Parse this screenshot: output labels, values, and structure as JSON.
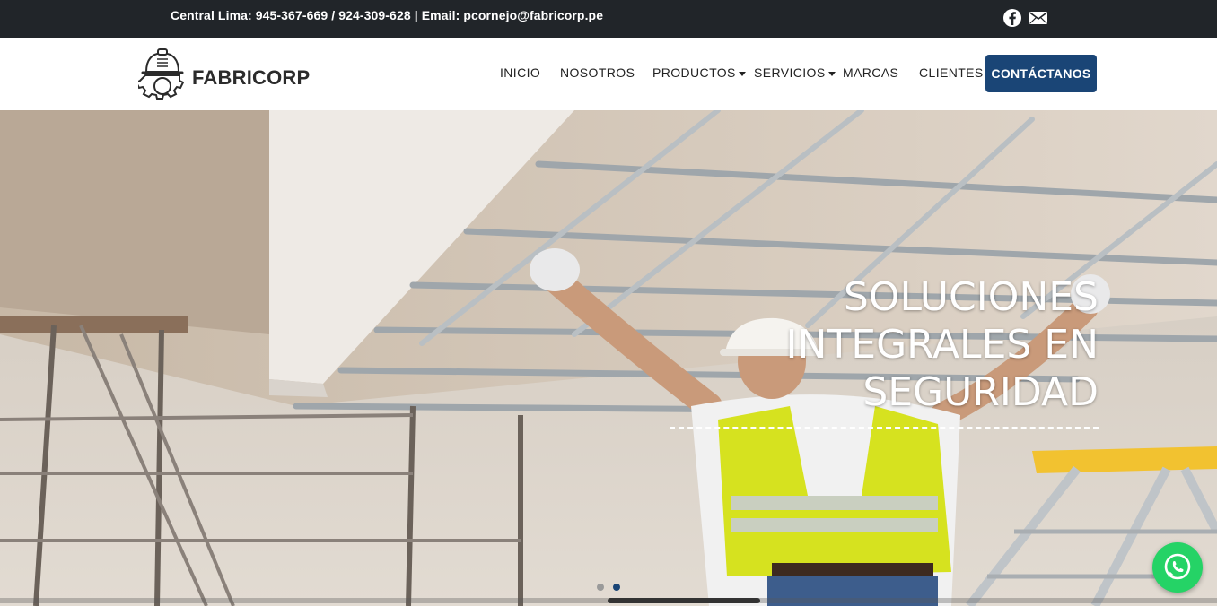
{
  "topbar": {
    "contact_text": "Central Lima: 945-367-669 / 924-309-628 | Email: pcornejo@fabricorp.pe",
    "icons": [
      "facebook-icon",
      "mail-icon"
    ]
  },
  "brand": {
    "name": "FABRICORP",
    "logo_icon": "worker-helmet-gear-icon"
  },
  "nav": {
    "items": [
      {
        "label": "INICIO",
        "has_dropdown": false
      },
      {
        "label": "NOSOTROS",
        "has_dropdown": false
      },
      {
        "label": "PRODUCTOS",
        "has_dropdown": true
      },
      {
        "label": "SERVICIOS",
        "has_dropdown": true
      },
      {
        "label": "MARCAS",
        "has_dropdown": false
      },
      {
        "label": "CLIENTES",
        "has_dropdown": false
      }
    ],
    "cta_label": "CONTÁCTANOS"
  },
  "hero": {
    "title_lines": [
      "SOLUCIONES",
      "INTEGRALES EN",
      "SEGURIDAD"
    ],
    "slides_count": 2,
    "active_slide": 2
  },
  "floating": {
    "whatsapp_icon": "whatsapp-icon"
  },
  "colors": {
    "topbar_bg": "#212529",
    "cta_bg": "#1a4576",
    "active_dot": "#1a4576",
    "inactive_dot": "#9a9a9a",
    "whatsapp_green": "#25d366"
  }
}
